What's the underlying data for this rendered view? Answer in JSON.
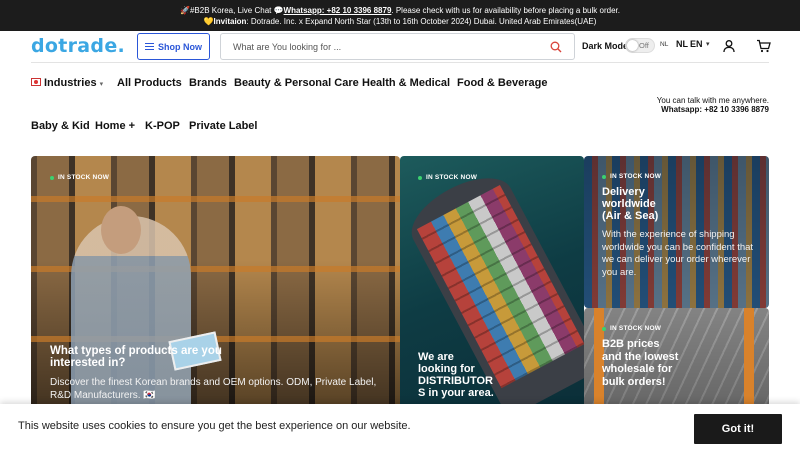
{
  "announcement": {
    "line1_prefix": "🚀#B2B Korea, Live Chat 💬",
    "line1_link": "Whatsapp: +82 10 3396 8879",
    "line1_suffix": ". Please check with us for availability before placing a bulk order.",
    "line2_label": "💛Invitaion",
    "line2_text": ": Dotrade. Inc. x Expand North Star (13th to 16th October 2024) Dubai. United Arab Emirates(UAE)"
  },
  "header": {
    "logo": "dotrade.",
    "shop_now": "Shop Now",
    "search_placeholder": "What are You looking for ...",
    "dark_mode_label": "Dark Mode",
    "dark_mode_state": "Off",
    "flag_code": "NL",
    "lang_country": "NL",
    "lang_code": "EN",
    "icons": [
      "search-icon",
      "user-icon",
      "cart-icon",
      "chevron-down-icon"
    ]
  },
  "nav": {
    "industries": "Industries",
    "items": [
      "All Products",
      "Brands",
      "Beauty & Personal Care",
      "Health & Medical",
      "Food & Beverage",
      "Baby & Kid",
      "Home +",
      "K-POP",
      "Private Label"
    ]
  },
  "chat_note": {
    "line1": "You can talk with me anywhere.",
    "line2": "Whatsapp: +82 10 3396 8879"
  },
  "tiles": [
    {
      "badge": "IN STOCK NOW",
      "title": "What types of products are you interested in?",
      "desc": "Discover the finest Korean brands and OEM options. ODM, Private Label, R&D Manufacturers. 🇰🇷"
    },
    {
      "badge": "IN STOCK NOW",
      "title": "We are looking for DISTRIBUTOR S in your area."
    },
    {
      "badge": "IN STOCK NOW",
      "title": "Delivery worldwide (Air & Sea)",
      "desc": "With the experience of shipping worldwide you can be confident that we can deliver your order wherever you are."
    },
    {
      "badge": "IN STOCK NOW",
      "title": "B2B prices and the lowest wholesale for bulk orders!"
    }
  ],
  "cookie": {
    "text": "This website uses cookies to ensure you get the best experience on our website.",
    "button": "Got it!"
  },
  "colors": {
    "brand": "#3ba7e3",
    "accent": "#2a56d8",
    "search_icon": "#d9433a",
    "badge_dot": "#3bd16f",
    "topbar": "#1c1c1c"
  }
}
